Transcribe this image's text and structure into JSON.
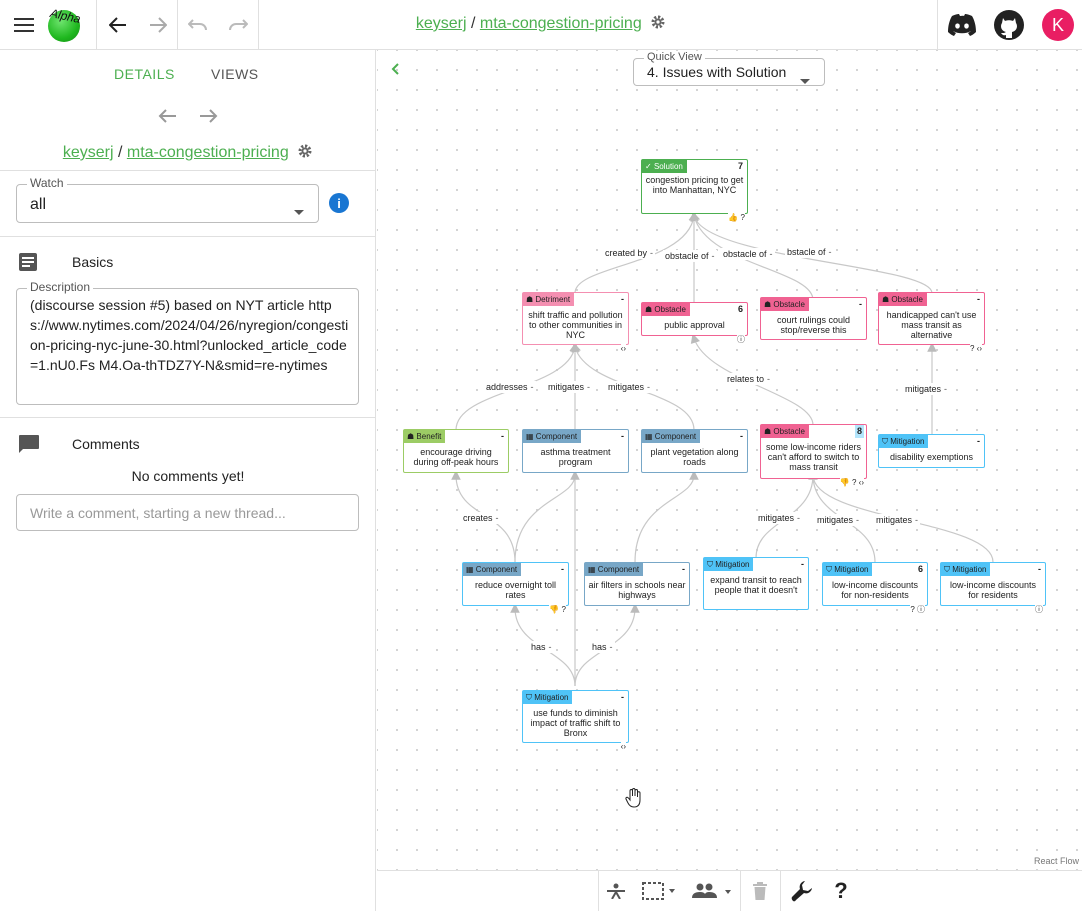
{
  "header": {
    "logo_text": "Alpha",
    "user": "keyserj",
    "separator": "/",
    "topic": "mta-congestion-pricing",
    "avatar_letter": "K"
  },
  "sidebar": {
    "tabs": [
      {
        "label": "DETAILS"
      },
      {
        "label": "VIEWS"
      }
    ],
    "user": "keyserj",
    "separator": "/",
    "topic": "mta-congestion-pricing",
    "watch": {
      "label": "Watch",
      "value": "all"
    },
    "basics": {
      "title": "Basics"
    },
    "description": {
      "label": "Description",
      "value": "(discourse session #5) based on NYT article https://www.nytimes.com/2024/04/26/nyregion/congestion-pricing-nyc-june-30.html?unlocked_article_code=1.nU0.Fs M4.Oa-thTDZ7Y-N&smid=re-nytimes"
    },
    "comments": {
      "title": "Comments",
      "empty": "No comments yet!",
      "placeholder": "Write a comment, starting a new thread..."
    }
  },
  "quick_view": {
    "label": "Quick View",
    "value": "4. Issues with Solution"
  },
  "colors": {
    "accent": "#4caf50",
    "solution": "#4caf50",
    "obstacle": "#f06292",
    "detriment": "#f48fb1",
    "benefit": "#9ccc65",
    "component": "#78a7c7",
    "mitigation": "#4fc3f7"
  },
  "nodes": [
    {
      "id": "sol",
      "type": "Solution",
      "icon": "✓",
      "text": "congestion pricing to get into Manhattan, NYC",
      "count": "7",
      "icons": "👍 ?"
    },
    {
      "id": "det",
      "type": "Detriment",
      "icon": "☗",
      "text": "shift traffic and pollution to other communities in NYC",
      "count": "-",
      "icons": "‹›"
    },
    {
      "id": "ob1",
      "type": "Obstacle",
      "icon": "☗",
      "text": "public approval",
      "count": "6",
      "icons": "ⓘ"
    },
    {
      "id": "ob2",
      "type": "Obstacle",
      "icon": "☗",
      "text": "court rulings could stop/reverse this",
      "count": "-",
      "icons": ""
    },
    {
      "id": "ob3",
      "type": "Obstacle",
      "icon": "☗",
      "text": "handicapped can't use mass transit as alternative",
      "count": "-",
      "icons": "? ‹›"
    },
    {
      "id": "ben",
      "type": "Benefit",
      "icon": "☗",
      "text": "encourage driving during off-peak hours",
      "count": "-",
      "icons": ""
    },
    {
      "id": "c1",
      "type": "Component",
      "icon": "▦",
      "text": "asthma treatment program",
      "count": "-",
      "icons": ""
    },
    {
      "id": "c2",
      "type": "Component",
      "icon": "▦",
      "text": "plant vegetation along roads",
      "count": "-",
      "icons": ""
    },
    {
      "id": "ob4",
      "type": "Obstacle",
      "icon": "☗",
      "text": "some low-income riders can't afford to switch to mass transit",
      "count": "8",
      "icons": "👎 ? ‹›"
    },
    {
      "id": "m1",
      "type": "Mitigation",
      "icon": "⛉",
      "text": "disability exemptions",
      "count": "-",
      "icons": ""
    },
    {
      "id": "c3",
      "type": "Component",
      "icon": "▦",
      "text": "reduce overnight toll rates",
      "count": "-",
      "icons": "👎 ?"
    },
    {
      "id": "c4",
      "type": "Component",
      "icon": "▦",
      "text": "air filters in schools near highways",
      "count": "-",
      "icons": ""
    },
    {
      "id": "m2",
      "type": "Mitigation",
      "icon": "⛉",
      "text": "expand transit to reach people that it doesn't",
      "count": "-",
      "icons": ""
    },
    {
      "id": "m3",
      "type": "Mitigation",
      "icon": "⛉",
      "text": "low-income discounts for non-residents",
      "count": "6",
      "icons": "? ⓘ"
    },
    {
      "id": "m4",
      "type": "Mitigation",
      "icon": "⛉",
      "text": "low-income discounts for residents",
      "count": "-",
      "icons": "ⓘ"
    },
    {
      "id": "m5",
      "type": "Mitigation",
      "icon": "⛉",
      "text": "use funds to diminish impact of traffic shift to Bronx",
      "count": "-",
      "icons": "‹›"
    }
  ],
  "edge_labels": [
    {
      "text": "created by"
    },
    {
      "text": "obstacle of"
    },
    {
      "text": "obstacle of"
    },
    {
      "text": "bstacle of"
    },
    {
      "text": "relates to"
    },
    {
      "text": "mitigates"
    },
    {
      "text": "addresses"
    },
    {
      "text": "mitigates"
    },
    {
      "text": "mitigates"
    },
    {
      "text": "creates"
    },
    {
      "text": "mitigates"
    },
    {
      "text": "mitigates"
    },
    {
      "text": "mitigates"
    },
    {
      "text": "has"
    },
    {
      "text": "has"
    }
  ],
  "edge_dash": "-",
  "watermark": "React Flow"
}
